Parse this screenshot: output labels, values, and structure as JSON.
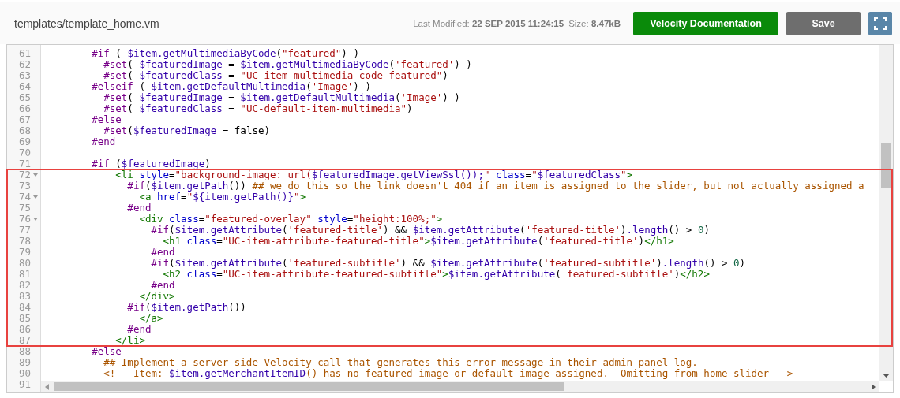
{
  "header": {
    "file_path": "templates/template_home.vm",
    "meta": [
      {
        "label": "Last Modified:",
        "value": "22 SEP 2015 11:24:15"
      },
      {
        "label": "Size:",
        "value": "8.47kB"
      }
    ],
    "buttons": [
      {
        "kind": "docs",
        "label": "Velocity Documentation"
      },
      {
        "kind": "save",
        "label": "Save"
      },
      {
        "kind": "fullscreen"
      }
    ]
  },
  "editor": {
    "lines": [
      {
        "number": "61",
        "foldable": false,
        "tokens": [
          {
            "kind": "directive",
            "text": "        #if"
          },
          {
            "kind": "plain",
            "text": " ( "
          },
          {
            "kind": "variable",
            "text": "$item.getMultimediaByCode"
          },
          {
            "kind": "plain",
            "text": "("
          },
          {
            "kind": "string",
            "text": "\"featured\""
          },
          {
            "kind": "plain",
            "text": ") )"
          }
        ]
      },
      {
        "number": "62",
        "foldable": false,
        "tokens": [
          {
            "kind": "directive",
            "text": "          #set"
          },
          {
            "kind": "plain",
            "text": "( "
          },
          {
            "kind": "variable",
            "text": "$featuredImage"
          },
          {
            "kind": "plain",
            "text": " = "
          },
          {
            "kind": "variable",
            "text": "$item.getMultimediaByCode"
          },
          {
            "kind": "plain",
            "text": "("
          },
          {
            "kind": "string",
            "text": "'featured'"
          },
          {
            "kind": "plain",
            "text": ") )"
          }
        ]
      },
      {
        "number": "63",
        "foldable": false,
        "tokens": [
          {
            "kind": "directive",
            "text": "          #set"
          },
          {
            "kind": "plain",
            "text": "( "
          },
          {
            "kind": "variable",
            "text": "$featuredClass"
          },
          {
            "kind": "plain",
            "text": " = "
          },
          {
            "kind": "string",
            "text": "\"UC-item-multimedia-code-featured\""
          },
          {
            "kind": "plain",
            "text": ")"
          }
        ]
      },
      {
        "number": "64",
        "foldable": false,
        "tokens": [
          {
            "kind": "directive",
            "text": "        #elseif"
          },
          {
            "kind": "plain",
            "text": " ( "
          },
          {
            "kind": "variable",
            "text": "$item.getDefaultMultimedia"
          },
          {
            "kind": "plain",
            "text": "("
          },
          {
            "kind": "string",
            "text": "'Image'"
          },
          {
            "kind": "plain",
            "text": ") )"
          }
        ]
      },
      {
        "number": "65",
        "foldable": false,
        "tokens": [
          {
            "kind": "directive",
            "text": "          #set"
          },
          {
            "kind": "plain",
            "text": "( "
          },
          {
            "kind": "variable",
            "text": "$featuredImage"
          },
          {
            "kind": "plain",
            "text": " = "
          },
          {
            "kind": "variable",
            "text": "$item.getDefaultMultimedia"
          },
          {
            "kind": "plain",
            "text": "("
          },
          {
            "kind": "string",
            "text": "'Image'"
          },
          {
            "kind": "plain",
            "text": ") )"
          }
        ]
      },
      {
        "number": "66",
        "foldable": false,
        "tokens": [
          {
            "kind": "directive",
            "text": "          #set"
          },
          {
            "kind": "plain",
            "text": "( "
          },
          {
            "kind": "variable",
            "text": "$featuredClass"
          },
          {
            "kind": "plain",
            "text": " = "
          },
          {
            "kind": "string",
            "text": "\"UC-default-item-multimedia\""
          },
          {
            "kind": "plain",
            "text": ")"
          }
        ]
      },
      {
        "number": "67",
        "foldable": false,
        "tokens": [
          {
            "kind": "directive",
            "text": "        #else"
          }
        ]
      },
      {
        "number": "68",
        "foldable": false,
        "tokens": [
          {
            "kind": "directive",
            "text": "          #set"
          },
          {
            "kind": "plain",
            "text": "("
          },
          {
            "kind": "variable",
            "text": "$featuredImage"
          },
          {
            "kind": "plain",
            "text": " = false)"
          }
        ]
      },
      {
        "number": "69",
        "foldable": false,
        "tokens": [
          {
            "kind": "directive",
            "text": "        #end"
          }
        ]
      },
      {
        "number": "70",
        "foldable": false
      },
      {
        "number": "71",
        "foldable": false,
        "tokens": [
          {
            "kind": "directive",
            "text": "        #if"
          },
          {
            "kind": "plain",
            "text": " ("
          },
          {
            "kind": "variable",
            "text": "$featuredImage"
          },
          {
            "kind": "plain",
            "text": ")"
          }
        ]
      },
      {
        "number": "72",
        "foldable": true,
        "tokens": [
          {
            "kind": "tag",
            "text": "            <li"
          },
          {
            "kind": "attribute",
            "text": " style"
          },
          {
            "kind": "plain",
            "text": "="
          },
          {
            "kind": "string",
            "text": "\"background-image: url("
          },
          {
            "kind": "variable",
            "text": "$featuredImage.getViewSsl());"
          },
          {
            "kind": "string",
            "text": "\""
          },
          {
            "kind": "attribute",
            "text": " class"
          },
          {
            "kind": "plain",
            "text": "="
          },
          {
            "kind": "string",
            "text": "\""
          },
          {
            "kind": "variable",
            "text": "$featuredClass"
          },
          {
            "kind": "string",
            "text": "\""
          },
          {
            "kind": "tag",
            "text": ">"
          }
        ]
      },
      {
        "number": "73",
        "foldable": false,
        "tokens": [
          {
            "kind": "directive",
            "text": "              #if"
          },
          {
            "kind": "plain",
            "text": "("
          },
          {
            "kind": "variable",
            "text": "$item.getPath"
          },
          {
            "kind": "plain",
            "text": "()) "
          },
          {
            "kind": "comment",
            "text": "## we do this so the link doesn't 404 if an item is assigned to the slider, but not actually assigned a"
          }
        ]
      },
      {
        "number": "74",
        "foldable": true,
        "tokens": [
          {
            "kind": "tag",
            "text": "                <a"
          },
          {
            "kind": "attribute",
            "text": " href"
          },
          {
            "kind": "plain",
            "text": "="
          },
          {
            "kind": "string",
            "text": "\""
          },
          {
            "kind": "variable",
            "text": "${item.getPath()}"
          },
          {
            "kind": "string",
            "text": "\""
          },
          {
            "kind": "tag",
            "text": ">"
          }
        ]
      },
      {
        "number": "75",
        "foldable": false,
        "tokens": [
          {
            "kind": "directive",
            "text": "              #end"
          }
        ]
      },
      {
        "number": "76",
        "foldable": true,
        "tokens": [
          {
            "kind": "tag",
            "text": "                <div"
          },
          {
            "kind": "attribute",
            "text": " class"
          },
          {
            "kind": "plain",
            "text": "="
          },
          {
            "kind": "string",
            "text": "\"featured-overlay\""
          },
          {
            "kind": "attribute",
            "text": " style"
          },
          {
            "kind": "plain",
            "text": "="
          },
          {
            "kind": "string",
            "text": "\"height:100%;\""
          },
          {
            "kind": "tag",
            "text": ">"
          }
        ]
      },
      {
        "number": "77",
        "foldable": false,
        "tokens": [
          {
            "kind": "directive",
            "text": "                  #if"
          },
          {
            "kind": "plain",
            "text": "("
          },
          {
            "kind": "variable",
            "text": "$item.getAttribute"
          },
          {
            "kind": "plain",
            "text": "("
          },
          {
            "kind": "string",
            "text": "'featured-title'"
          },
          {
            "kind": "plain",
            "text": ") && "
          },
          {
            "kind": "variable",
            "text": "$item.getAttribute"
          },
          {
            "kind": "plain",
            "text": "("
          },
          {
            "kind": "string",
            "text": "'featured-title'"
          },
          {
            "kind": "plain",
            "text": ")"
          },
          {
            "kind": "variable",
            "text": ".length"
          },
          {
            "kind": "plain",
            "text": "() > "
          },
          {
            "kind": "number",
            "text": "0"
          },
          {
            "kind": "plain",
            "text": ")"
          }
        ]
      },
      {
        "number": "78",
        "foldable": false,
        "tokens": [
          {
            "kind": "tag",
            "text": "                    <h1"
          },
          {
            "kind": "attribute",
            "text": " class"
          },
          {
            "kind": "plain",
            "text": "="
          },
          {
            "kind": "string",
            "text": "\"UC-item-attribute-featured-title\""
          },
          {
            "kind": "tag",
            "text": ">"
          },
          {
            "kind": "variable",
            "text": "$item.getAttribute"
          },
          {
            "kind": "plain",
            "text": "("
          },
          {
            "kind": "string",
            "text": "'featured-title'"
          },
          {
            "kind": "plain",
            "text": ")"
          },
          {
            "kind": "tag",
            "text": "</h1>"
          }
        ]
      },
      {
        "number": "79",
        "foldable": false,
        "tokens": [
          {
            "kind": "directive",
            "text": "                  #end"
          }
        ]
      },
      {
        "number": "80",
        "foldable": false,
        "tokens": [
          {
            "kind": "directive",
            "text": "                  #if"
          },
          {
            "kind": "plain",
            "text": "("
          },
          {
            "kind": "variable",
            "text": "$item.getAttribute"
          },
          {
            "kind": "plain",
            "text": "("
          },
          {
            "kind": "string",
            "text": "'featured-subtitle'"
          },
          {
            "kind": "plain",
            "text": ") && "
          },
          {
            "kind": "variable",
            "text": "$item.getAttribute"
          },
          {
            "kind": "plain",
            "text": "("
          },
          {
            "kind": "string",
            "text": "'featured-subtitle'"
          },
          {
            "kind": "plain",
            "text": ")"
          },
          {
            "kind": "variable",
            "text": ".length"
          },
          {
            "kind": "plain",
            "text": "() > "
          },
          {
            "kind": "number",
            "text": "0"
          },
          {
            "kind": "plain",
            "text": ")"
          }
        ]
      },
      {
        "number": "81",
        "foldable": false,
        "tokens": [
          {
            "kind": "tag",
            "text": "                    <h2"
          },
          {
            "kind": "attribute",
            "text": " class"
          },
          {
            "kind": "plain",
            "text": "="
          },
          {
            "kind": "string",
            "text": "\"UC-item-attribute-featured-subtitle\""
          },
          {
            "kind": "tag",
            "text": ">"
          },
          {
            "kind": "variable",
            "text": "$item.getAttribute"
          },
          {
            "kind": "plain",
            "text": "("
          },
          {
            "kind": "string",
            "text": "'featured-subtitle'"
          },
          {
            "kind": "plain",
            "text": ")"
          },
          {
            "kind": "tag",
            "text": "</h2>"
          }
        ]
      },
      {
        "number": "82",
        "foldable": false,
        "tokens": [
          {
            "kind": "directive",
            "text": "                  #end"
          }
        ]
      },
      {
        "number": "83",
        "foldable": false,
        "tokens": [
          {
            "kind": "tag",
            "text": "                </div>"
          }
        ]
      },
      {
        "number": "84",
        "foldable": false,
        "tokens": [
          {
            "kind": "directive",
            "text": "              #if"
          },
          {
            "kind": "plain",
            "text": "("
          },
          {
            "kind": "variable",
            "text": "$item.getPath"
          },
          {
            "kind": "plain",
            "text": "())"
          }
        ]
      },
      {
        "number": "85",
        "foldable": false,
        "tokens": [
          {
            "kind": "tag",
            "text": "                </a>"
          }
        ]
      },
      {
        "number": "86",
        "foldable": false,
        "tokens": [
          {
            "kind": "directive",
            "text": "              #end"
          }
        ]
      },
      {
        "number": "87",
        "foldable": false,
        "tokens": [
          {
            "kind": "tag",
            "text": "            </li>"
          }
        ]
      },
      {
        "number": "88",
        "foldable": false,
        "tokens": [
          {
            "kind": "directive",
            "text": "        #else"
          }
        ]
      },
      {
        "number": "89",
        "foldable": false,
        "tokens": [
          {
            "kind": "comment",
            "text": "          ## Implement a server side Velocity call that generates this error message in their admin panel log."
          }
        ]
      },
      {
        "number": "90",
        "foldable": false,
        "tokens": [
          {
            "kind": "comment",
            "text": "          <!-- Item: "
          },
          {
            "kind": "variable",
            "text": "$item.getMerchantItemID"
          },
          {
            "kind": "comment",
            "text": "() has no featured image or default image assigned.  Omitting from home slider -->"
          }
        ]
      },
      {
        "number": "91",
        "foldable": false
      }
    ]
  }
}
